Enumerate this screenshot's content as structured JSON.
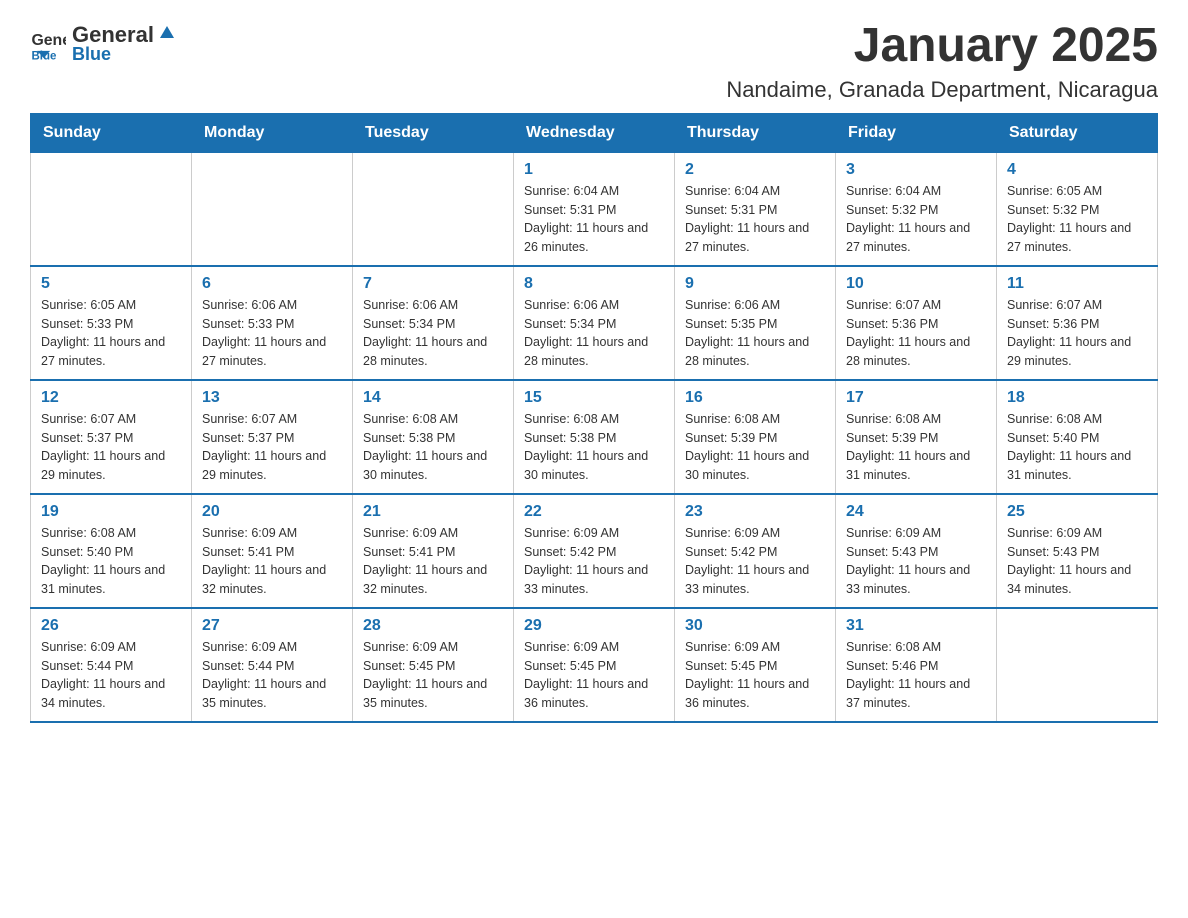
{
  "logo": {
    "text_general": "General",
    "text_blue": "Blue"
  },
  "header": {
    "title": "January 2025",
    "subtitle": "Nandaime, Granada Department, Nicaragua"
  },
  "days_of_week": [
    "Sunday",
    "Monday",
    "Tuesday",
    "Wednesday",
    "Thursday",
    "Friday",
    "Saturday"
  ],
  "weeks": [
    [
      {
        "day": "",
        "info": ""
      },
      {
        "day": "",
        "info": ""
      },
      {
        "day": "",
        "info": ""
      },
      {
        "day": "1",
        "info": "Sunrise: 6:04 AM\nSunset: 5:31 PM\nDaylight: 11 hours and 26 minutes."
      },
      {
        "day": "2",
        "info": "Sunrise: 6:04 AM\nSunset: 5:31 PM\nDaylight: 11 hours and 27 minutes."
      },
      {
        "day": "3",
        "info": "Sunrise: 6:04 AM\nSunset: 5:32 PM\nDaylight: 11 hours and 27 minutes."
      },
      {
        "day": "4",
        "info": "Sunrise: 6:05 AM\nSunset: 5:32 PM\nDaylight: 11 hours and 27 minutes."
      }
    ],
    [
      {
        "day": "5",
        "info": "Sunrise: 6:05 AM\nSunset: 5:33 PM\nDaylight: 11 hours and 27 minutes."
      },
      {
        "day": "6",
        "info": "Sunrise: 6:06 AM\nSunset: 5:33 PM\nDaylight: 11 hours and 27 minutes."
      },
      {
        "day": "7",
        "info": "Sunrise: 6:06 AM\nSunset: 5:34 PM\nDaylight: 11 hours and 28 minutes."
      },
      {
        "day": "8",
        "info": "Sunrise: 6:06 AM\nSunset: 5:34 PM\nDaylight: 11 hours and 28 minutes."
      },
      {
        "day": "9",
        "info": "Sunrise: 6:06 AM\nSunset: 5:35 PM\nDaylight: 11 hours and 28 minutes."
      },
      {
        "day": "10",
        "info": "Sunrise: 6:07 AM\nSunset: 5:36 PM\nDaylight: 11 hours and 28 minutes."
      },
      {
        "day": "11",
        "info": "Sunrise: 6:07 AM\nSunset: 5:36 PM\nDaylight: 11 hours and 29 minutes."
      }
    ],
    [
      {
        "day": "12",
        "info": "Sunrise: 6:07 AM\nSunset: 5:37 PM\nDaylight: 11 hours and 29 minutes."
      },
      {
        "day": "13",
        "info": "Sunrise: 6:07 AM\nSunset: 5:37 PM\nDaylight: 11 hours and 29 minutes."
      },
      {
        "day": "14",
        "info": "Sunrise: 6:08 AM\nSunset: 5:38 PM\nDaylight: 11 hours and 30 minutes."
      },
      {
        "day": "15",
        "info": "Sunrise: 6:08 AM\nSunset: 5:38 PM\nDaylight: 11 hours and 30 minutes."
      },
      {
        "day": "16",
        "info": "Sunrise: 6:08 AM\nSunset: 5:39 PM\nDaylight: 11 hours and 30 minutes."
      },
      {
        "day": "17",
        "info": "Sunrise: 6:08 AM\nSunset: 5:39 PM\nDaylight: 11 hours and 31 minutes."
      },
      {
        "day": "18",
        "info": "Sunrise: 6:08 AM\nSunset: 5:40 PM\nDaylight: 11 hours and 31 minutes."
      }
    ],
    [
      {
        "day": "19",
        "info": "Sunrise: 6:08 AM\nSunset: 5:40 PM\nDaylight: 11 hours and 31 minutes."
      },
      {
        "day": "20",
        "info": "Sunrise: 6:09 AM\nSunset: 5:41 PM\nDaylight: 11 hours and 32 minutes."
      },
      {
        "day": "21",
        "info": "Sunrise: 6:09 AM\nSunset: 5:41 PM\nDaylight: 11 hours and 32 minutes."
      },
      {
        "day": "22",
        "info": "Sunrise: 6:09 AM\nSunset: 5:42 PM\nDaylight: 11 hours and 33 minutes."
      },
      {
        "day": "23",
        "info": "Sunrise: 6:09 AM\nSunset: 5:42 PM\nDaylight: 11 hours and 33 minutes."
      },
      {
        "day": "24",
        "info": "Sunrise: 6:09 AM\nSunset: 5:43 PM\nDaylight: 11 hours and 33 minutes."
      },
      {
        "day": "25",
        "info": "Sunrise: 6:09 AM\nSunset: 5:43 PM\nDaylight: 11 hours and 34 minutes."
      }
    ],
    [
      {
        "day": "26",
        "info": "Sunrise: 6:09 AM\nSunset: 5:44 PM\nDaylight: 11 hours and 34 minutes."
      },
      {
        "day": "27",
        "info": "Sunrise: 6:09 AM\nSunset: 5:44 PM\nDaylight: 11 hours and 35 minutes."
      },
      {
        "day": "28",
        "info": "Sunrise: 6:09 AM\nSunset: 5:45 PM\nDaylight: 11 hours and 35 minutes."
      },
      {
        "day": "29",
        "info": "Sunrise: 6:09 AM\nSunset: 5:45 PM\nDaylight: 11 hours and 36 minutes."
      },
      {
        "day": "30",
        "info": "Sunrise: 6:09 AM\nSunset: 5:45 PM\nDaylight: 11 hours and 36 minutes."
      },
      {
        "day": "31",
        "info": "Sunrise: 6:08 AM\nSunset: 5:46 PM\nDaylight: 11 hours and 37 minutes."
      },
      {
        "day": "",
        "info": ""
      }
    ]
  ]
}
